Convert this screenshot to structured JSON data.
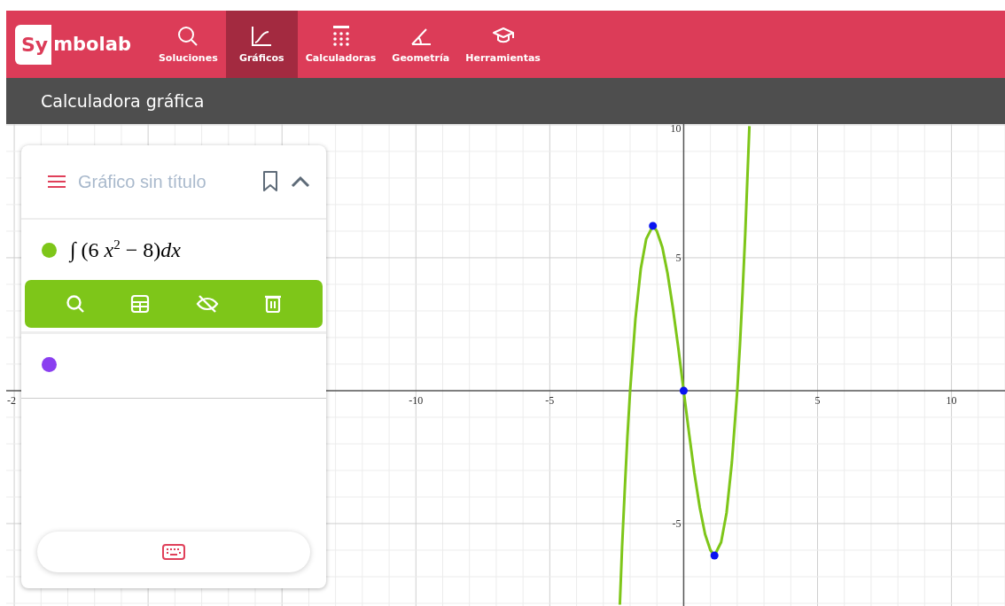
{
  "header": {
    "logo": {
      "boxed": "Sy",
      "rest": "mbolab"
    },
    "nav": [
      {
        "label": "Soluciones",
        "selected": false
      },
      {
        "label": "Gráficos",
        "selected": true
      },
      {
        "label": "Calculadoras",
        "selected": false
      },
      {
        "label": "Geometría",
        "selected": false
      },
      {
        "label": "Herramientas",
        "selected": false
      }
    ]
  },
  "page_title": "Calculadora gráfica",
  "panel": {
    "title_placeholder": "Gráfico sin título",
    "expressions": [
      {
        "formula": "∫ (6 *x*$^{2}$ − 8)*dx*",
        "color": "#7ec619",
        "selected": true
      },
      {
        "color": "#8a3ff0",
        "selected": false
      }
    ]
  },
  "graph": {
    "edge_label": "-2",
    "chart_data": {
      "type": "line",
      "grid": true,
      "xlim": [
        -25.3,
        12
      ],
      "ylim": [
        -8.1,
        10.03
      ],
      "xticks": [
        -10,
        -5,
        5,
        10
      ],
      "yticks": [
        -5,
        5,
        10
      ],
      "x": [
        -2.385,
        -2.35,
        -2.3,
        -2.2,
        -2.1,
        -2.0,
        -1.8,
        -1.6,
        -1.4,
        -1.2,
        -1.15,
        -1.0,
        -0.8,
        -0.6,
        -0.4,
        -0.2,
        0,
        0.2,
        0.4,
        0.6,
        0.8,
        1.0,
        1.15,
        1.2,
        1.4,
        1.6,
        1.8,
        2.0,
        2.1,
        2.2,
        2.3,
        2.35,
        2.455
      ],
      "series": [
        {
          "color": "#7ec619",
          "values": [
            -8.05,
            -7.2,
            -5.9,
            -3.7,
            -1.7,
            0,
            2.7,
            4.6,
            5.7,
            6.1,
            6.2,
            6,
            5.4,
            4.4,
            3.1,
            1.6,
            0,
            -1.6,
            -3.1,
            -4.4,
            -5.4,
            -6,
            -6.2,
            -6.1,
            -5.7,
            -4.6,
            -2.7,
            0,
            1.7,
            3.7,
            5.9,
            7.2,
            9.95
          ]
        },
        {
          "type": "scatter",
          "color": "#0a14f0",
          "values": [
            null,
            null,
            null,
            null,
            null,
            null,
            null,
            null,
            null,
            null,
            6.2,
            null,
            null,
            null,
            null,
            null,
            0,
            null,
            null,
            null,
            null,
            null,
            -6.2,
            null,
            null,
            null,
            null,
            null,
            null,
            null,
            null,
            null,
            null
          ]
        }
      ]
    }
  }
}
